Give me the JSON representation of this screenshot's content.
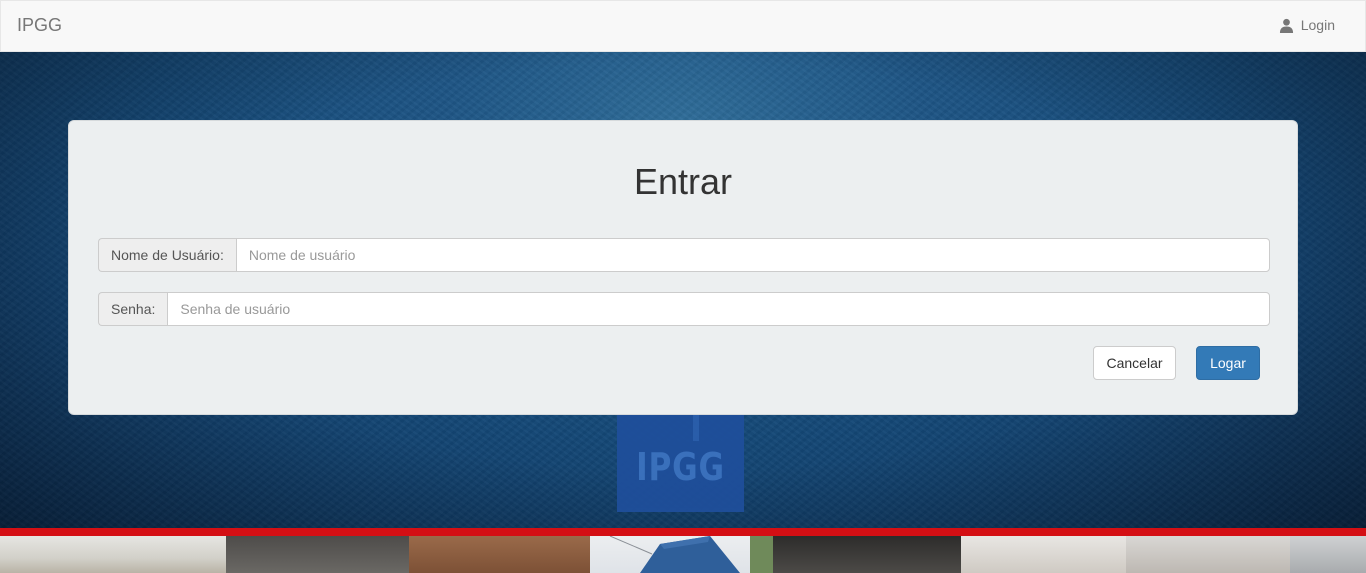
{
  "navbar": {
    "brand": "IPGG",
    "login_label": "Login",
    "login_icon": "user-icon"
  },
  "background": {
    "logo_text": "IPGG",
    "accent_red": "#d40f14",
    "logo_blue": "#1f4f9c"
  },
  "login_form": {
    "title": "Entrar",
    "username": {
      "label": "Nome de Usuário:",
      "placeholder": "Nome de usuário",
      "value": ""
    },
    "password": {
      "label": "Senha:",
      "placeholder": "Senha de usuário",
      "value": ""
    },
    "cancel_label": "Cancelar",
    "submit_label": "Logar",
    "submit_color": "#337ab7"
  }
}
